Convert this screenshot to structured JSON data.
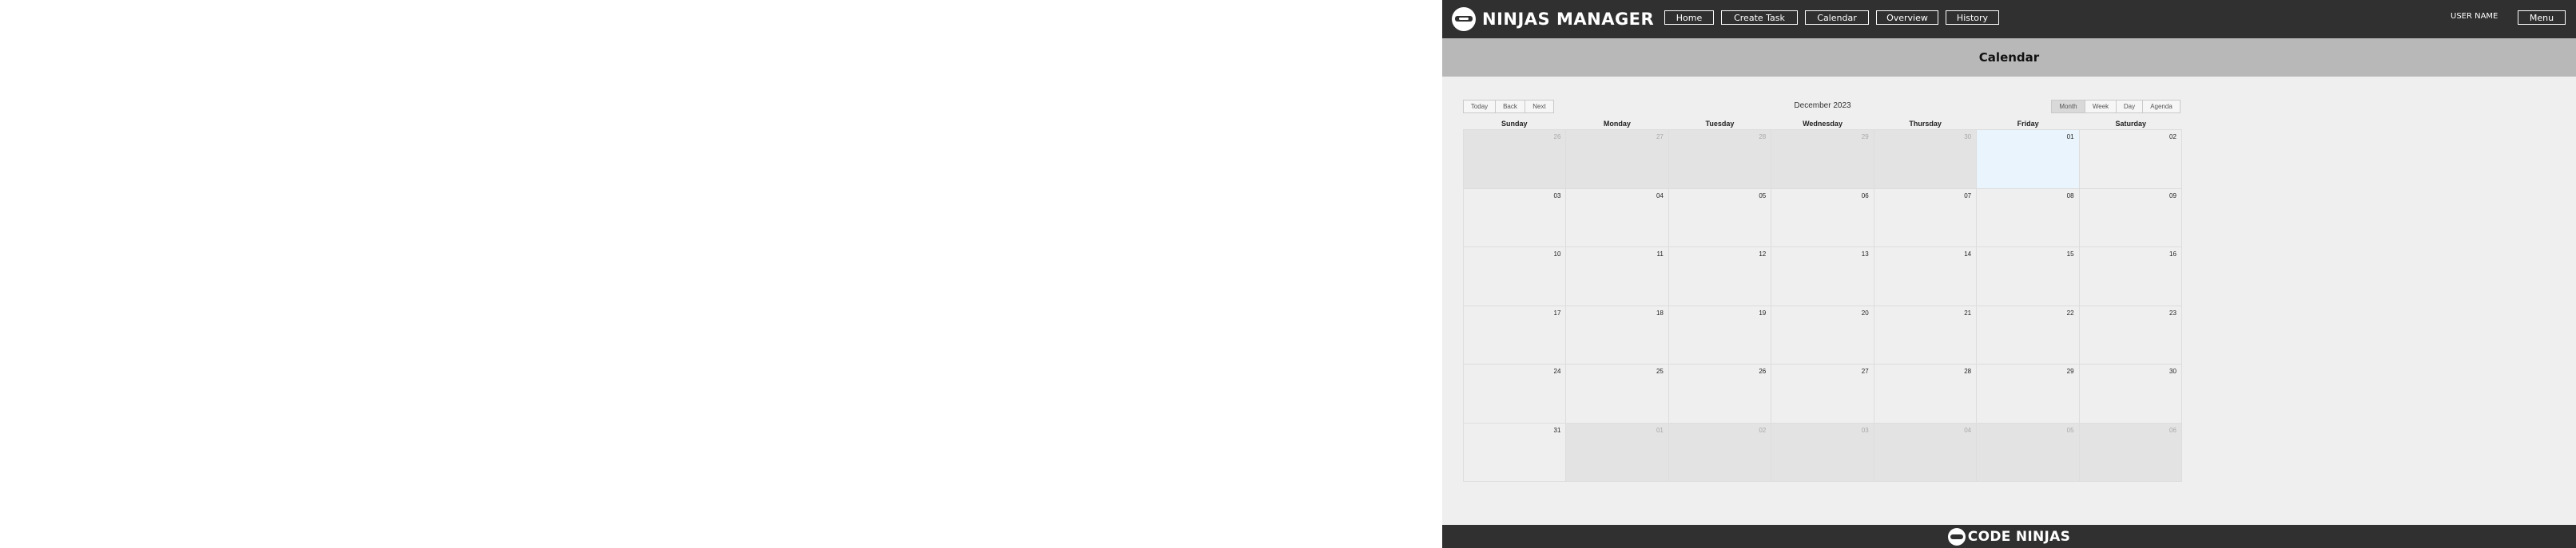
{
  "header": {
    "brand": "NINJAS MANAGER",
    "logo_icon": "ninja-head-logo-icon",
    "nav": [
      {
        "label": "Home"
      },
      {
        "label": "Create Task"
      },
      {
        "label": "Calendar"
      },
      {
        "label": "Overview"
      },
      {
        "label": "History"
      }
    ],
    "user_name": "USER NAME",
    "menu_label": "Menu"
  },
  "page": {
    "title": "Calendar"
  },
  "toolbar": {
    "nav_buttons": [
      {
        "label": "Today"
      },
      {
        "label": "Back"
      },
      {
        "label": "Next"
      }
    ],
    "label": "December 2023",
    "views": [
      {
        "label": "Month",
        "active": true
      },
      {
        "label": "Week",
        "active": false
      },
      {
        "label": "Day",
        "active": false
      },
      {
        "label": "Agenda",
        "active": false
      }
    ]
  },
  "calendar": {
    "weekdays": [
      "Sunday",
      "Monday",
      "Tuesday",
      "Wednesday",
      "Thursday",
      "Friday",
      "Saturday"
    ],
    "weeks": [
      [
        {
          "num": "26",
          "off": true
        },
        {
          "num": "27",
          "off": true
        },
        {
          "num": "28",
          "off": true
        },
        {
          "num": "29",
          "off": true
        },
        {
          "num": "30",
          "off": true
        },
        {
          "num": "01",
          "today": true
        },
        {
          "num": "02"
        }
      ],
      [
        {
          "num": "03"
        },
        {
          "num": "04"
        },
        {
          "num": "05"
        },
        {
          "num": "06"
        },
        {
          "num": "07"
        },
        {
          "num": "08"
        },
        {
          "num": "09"
        }
      ],
      [
        {
          "num": "10"
        },
        {
          "num": "11"
        },
        {
          "num": "12"
        },
        {
          "num": "13"
        },
        {
          "num": "14"
        },
        {
          "num": "15"
        },
        {
          "num": "16"
        }
      ],
      [
        {
          "num": "17"
        },
        {
          "num": "18"
        },
        {
          "num": "19"
        },
        {
          "num": "20"
        },
        {
          "num": "21"
        },
        {
          "num": "22"
        },
        {
          "num": "23"
        }
      ],
      [
        {
          "num": "24"
        },
        {
          "num": "25"
        },
        {
          "num": "26"
        },
        {
          "num": "27"
        },
        {
          "num": "28"
        },
        {
          "num": "29"
        },
        {
          "num": "30"
        }
      ],
      [
        {
          "num": "31"
        },
        {
          "num": "01",
          "off": true
        },
        {
          "num": "02",
          "off": true
        },
        {
          "num": "03",
          "off": true
        },
        {
          "num": "04",
          "off": true
        },
        {
          "num": "05",
          "off": true
        },
        {
          "num": "06",
          "off": true
        }
      ]
    ]
  },
  "footer": {
    "brand": "CODE NINJAS",
    "logo_icon": "ninja-head-logo-icon"
  }
}
